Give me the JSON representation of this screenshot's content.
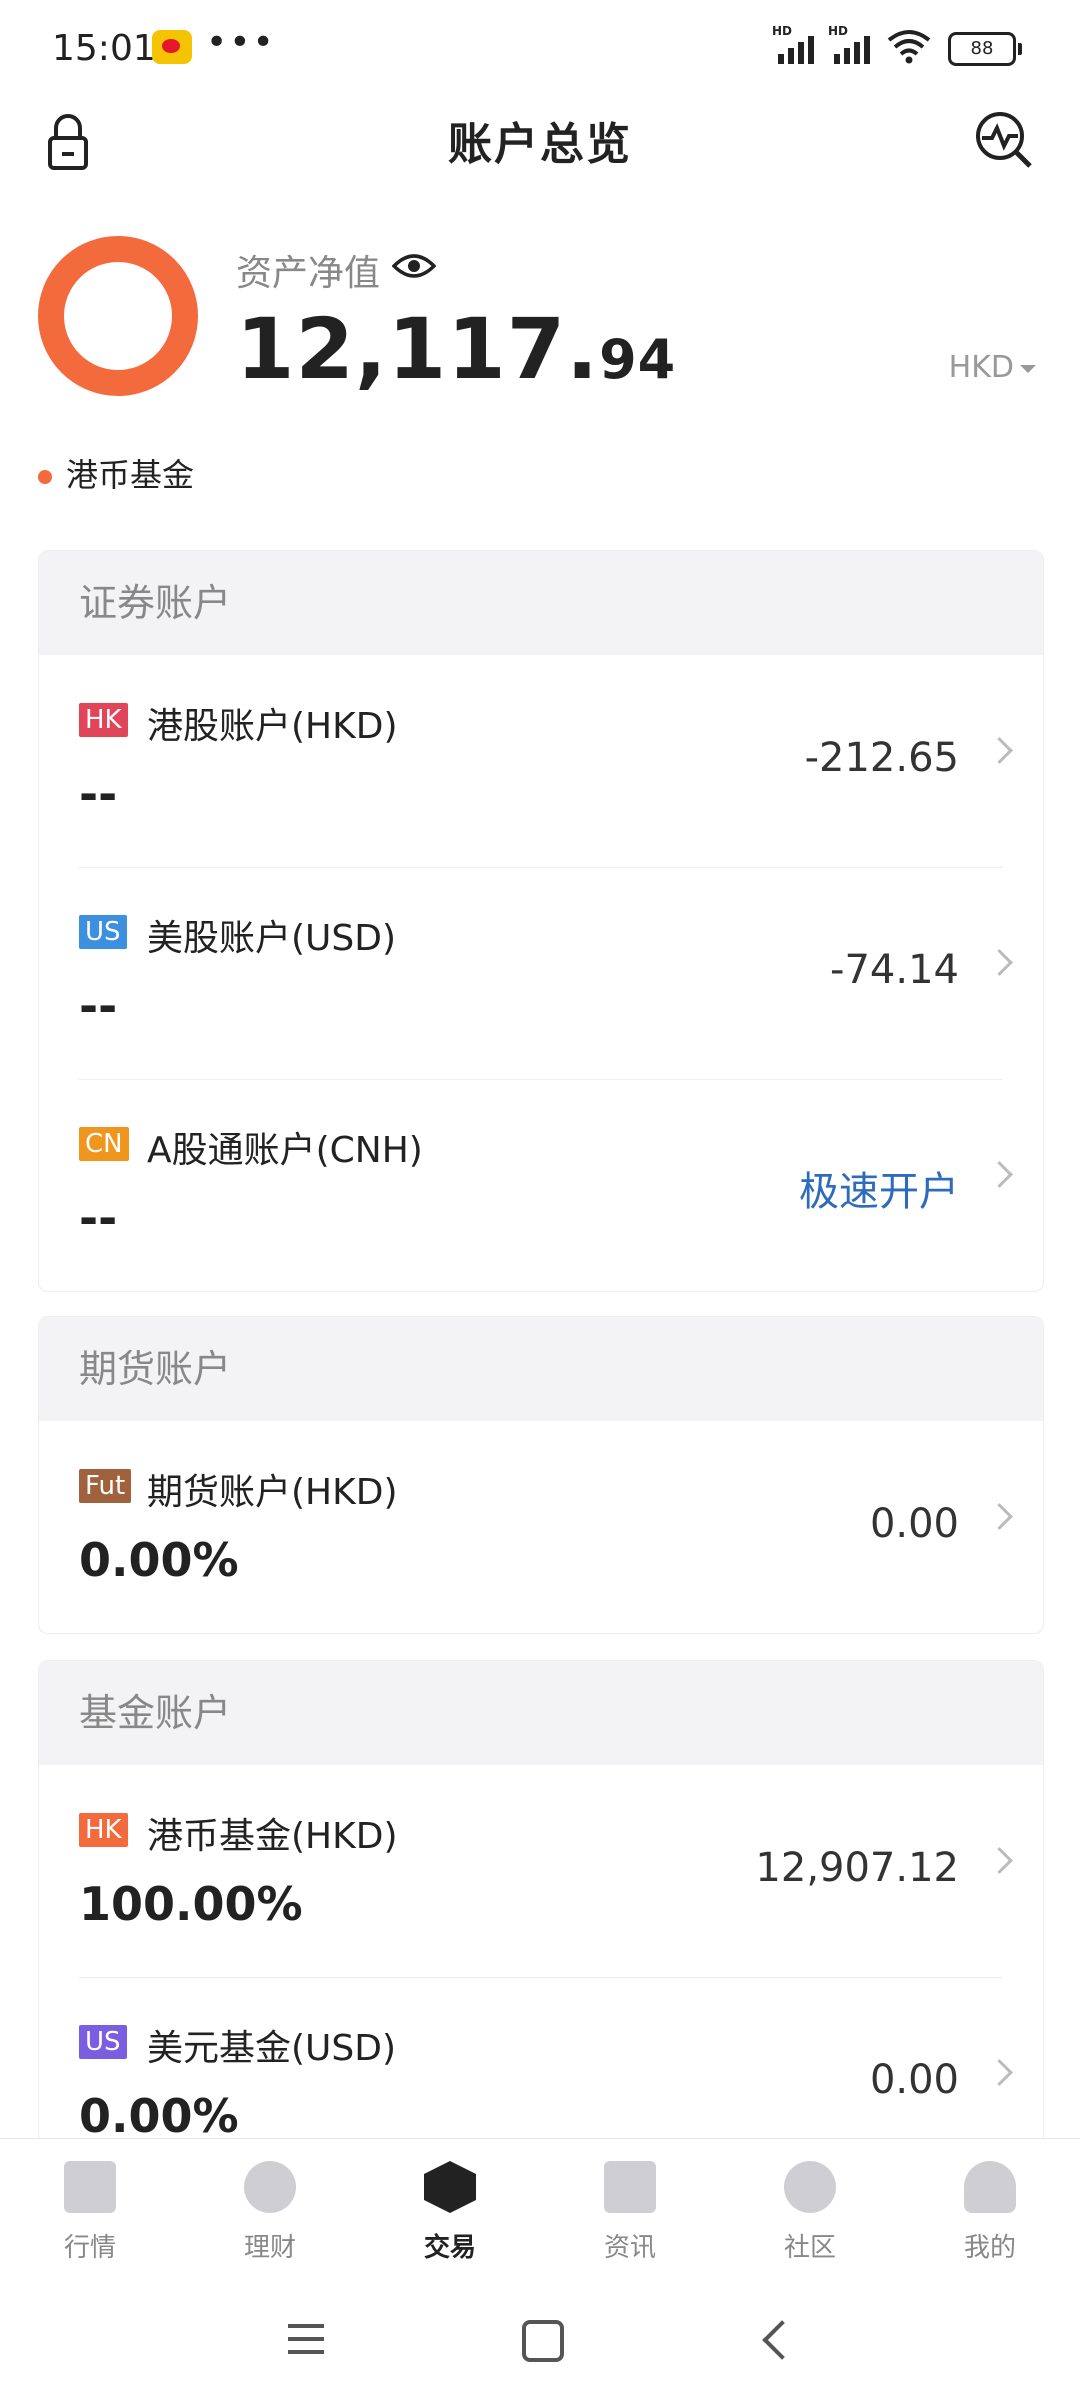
{
  "status_bar": {
    "time": "15:01",
    "dots": "•••",
    "battery": "88",
    "hd1": "HD",
    "hd2": "HD"
  },
  "header": {
    "title": "账户总览"
  },
  "summary": {
    "label": "资产净值",
    "value_int": "12,117.",
    "value_dec": "94",
    "currency": "HKD",
    "legend": "港币基金",
    "donut_color": "#f36a3d"
  },
  "sections": [
    {
      "title": "证券账户",
      "rows": [
        {
          "tag": "HK",
          "tag_color": "#e0455a",
          "name": "港股账户(HKD)",
          "sub": "--",
          "value": "-212.65"
        },
        {
          "tag": "US",
          "tag_color": "#3d8fe0",
          "name": "美股账户(USD)",
          "sub": "--",
          "value": "-74.14"
        },
        {
          "tag": "CN",
          "tag_color": "#f0951d",
          "name": "A股通账户(CNH)",
          "sub": "--",
          "value": "极速开户"
        }
      ]
    },
    {
      "title": "期货账户",
      "rows": [
        {
          "tag": "Fut",
          "tag_color": "#a0623d",
          "name": "期货账户(HKD)",
          "sub": "0.00%",
          "value": "0.00"
        }
      ]
    },
    {
      "title": "基金账户",
      "rows": [
        {
          "tag": "HK",
          "tag_color": "#f36a3d",
          "name": "港币基金(HKD)",
          "sub": "100.00%",
          "value": "12,907.12"
        },
        {
          "tag": "US",
          "tag_color": "#7a5de0",
          "name": "美元基金(USD)",
          "sub": "0.00%",
          "value": "0.00"
        }
      ]
    }
  ],
  "tabbar": [
    {
      "label": "行情",
      "icon": "chart-bar-icon"
    },
    {
      "label": "理财",
      "icon": "diamond-icon"
    },
    {
      "label": "交易",
      "icon": "exchange-icon"
    },
    {
      "label": "资讯",
      "icon": "news-icon"
    },
    {
      "label": "社区",
      "icon": "community-icon"
    },
    {
      "label": "我的",
      "icon": "profile-icon"
    }
  ]
}
